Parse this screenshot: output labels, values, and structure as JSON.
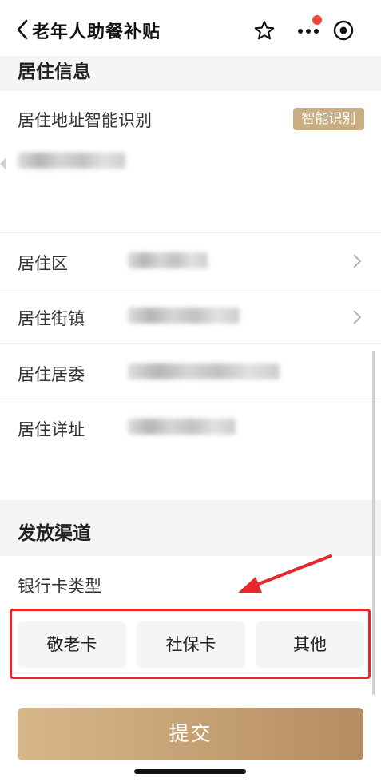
{
  "nav": {
    "title": "老年人助餐补贴",
    "icons": [
      "back-icon",
      "star-icon",
      "more-icon",
      "target-icon"
    ],
    "notification_dot_color": "#f04438"
  },
  "residence": {
    "section_title": "居住信息",
    "smart_label": "居住地址智能识别",
    "smart_button": "智能识别",
    "rows": [
      {
        "label": "居住区"
      },
      {
        "label": "居住街镇"
      },
      {
        "label": "居住居委"
      },
      {
        "label": "居住详址"
      }
    ]
  },
  "channel": {
    "section_title": "发放渠道",
    "bank_label": "银行卡类型",
    "options": [
      "敬老卡",
      "社保卡",
      "其他"
    ]
  },
  "submit_label": "提交",
  "colors": {
    "accent_gold": "#c8ae82",
    "highlight_red": "#e8262b"
  }
}
